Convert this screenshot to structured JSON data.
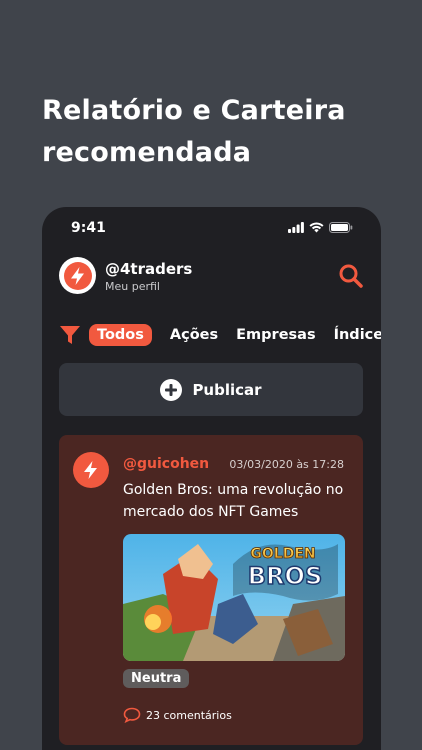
{
  "headline": {
    "line1": "Relatório e Carteira",
    "line2": "recomendada"
  },
  "status_bar": {
    "time": "9:41",
    "icons": [
      "signal-icon",
      "wifi-icon",
      "battery-icon"
    ]
  },
  "profile": {
    "handle": "@4traders",
    "subtitle": "Meu perfil",
    "logo_icon": "four-logo-icon",
    "search_icon": "search-icon"
  },
  "filters": {
    "icon": "filter-icon",
    "chips": [
      "Todos",
      "Ações",
      "Empresas",
      "Índices"
    ],
    "active": "Todos"
  },
  "publish": {
    "label": "Publicar",
    "icon": "plus-circle-icon"
  },
  "post": {
    "user": "@guicohen",
    "date": "03/03/2020 às 17:28",
    "title": "Golden Bros: uma revolução no mercado dos NFT Games",
    "image_title": "GOLDEN BROS",
    "tag": "Neutra",
    "comments": "23 comentários"
  },
  "colors": {
    "accent": "#f1593f",
    "background": "#40444b",
    "phone": "#1f1f23",
    "card": "#4b2622",
    "publish": "#33363d"
  }
}
